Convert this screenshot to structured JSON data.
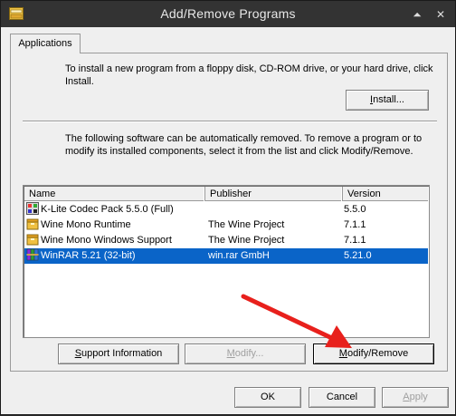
{
  "window": {
    "title": "Add/Remove Programs",
    "controls": {
      "rollup_glyph": "⏶",
      "close_glyph": "✕"
    }
  },
  "tabs": [
    {
      "label": "Applications",
      "active": true
    }
  ],
  "install_section": {
    "description": "To install a new program from a floppy disk, CD-ROM drive, or your hard drive, click Install.",
    "install_button": "Install..."
  },
  "remove_section": {
    "description": "The following software can be automatically removed. To remove a program or to modify its installed components, select it from the list and click Modify/Remove."
  },
  "program_list": {
    "columns": [
      "Name",
      "Publisher",
      "Version"
    ],
    "rows": [
      {
        "name": "K-Lite Codec Pack 5.5.0 (Full)",
        "publisher": "",
        "version": "5.5.0",
        "icon": "klite-codec-icon",
        "selected": false
      },
      {
        "name": "Wine Mono Runtime",
        "publisher": "The Wine Project",
        "version": "7.1.1",
        "icon": "wine-installer-icon",
        "selected": false
      },
      {
        "name": "Wine Mono Windows Support",
        "publisher": "The Wine Project",
        "version": "7.1.1",
        "icon": "wine-installer-icon",
        "selected": false
      },
      {
        "name": "WinRAR 5.21 (32-bit)",
        "publisher": "win.rar GmbH",
        "version": "5.21.0",
        "icon": "winrar-icon",
        "selected": true
      }
    ]
  },
  "action_buttons": {
    "support_info": "Support Information",
    "modify": "Modify...",
    "modify_remove": "Modify/Remove"
  },
  "footer_buttons": {
    "ok": "OK",
    "cancel": "Cancel",
    "apply": "Apply"
  },
  "colors": {
    "selection": "#0a64c8",
    "annotation_arrow": "#e8201c",
    "titlebar": "#333333"
  }
}
